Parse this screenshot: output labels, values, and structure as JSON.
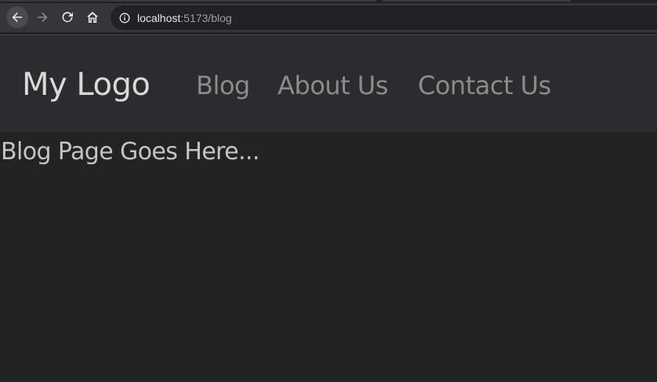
{
  "browser": {
    "url_host": "localhost",
    "url_rest": ":5173/blog",
    "icons": {
      "back": "arrow-left-icon",
      "forward": "arrow-right-icon",
      "reload": "reload-icon",
      "home": "home-icon",
      "info": "info-icon"
    }
  },
  "header": {
    "logo": "My Logo",
    "nav": [
      {
        "label": "Blog"
      },
      {
        "label": "About Us"
      },
      {
        "label": "Contact Us"
      }
    ]
  },
  "main": {
    "text": "Blog Page Goes Here..."
  },
  "colors": {
    "page_background": "#212325",
    "header_background": "#2b2c2f",
    "toolbar_background": "#35363a",
    "logo_text": "#d9d9d9",
    "nav_text": "#8a8b8d",
    "body_text": "#c4c4c4"
  }
}
